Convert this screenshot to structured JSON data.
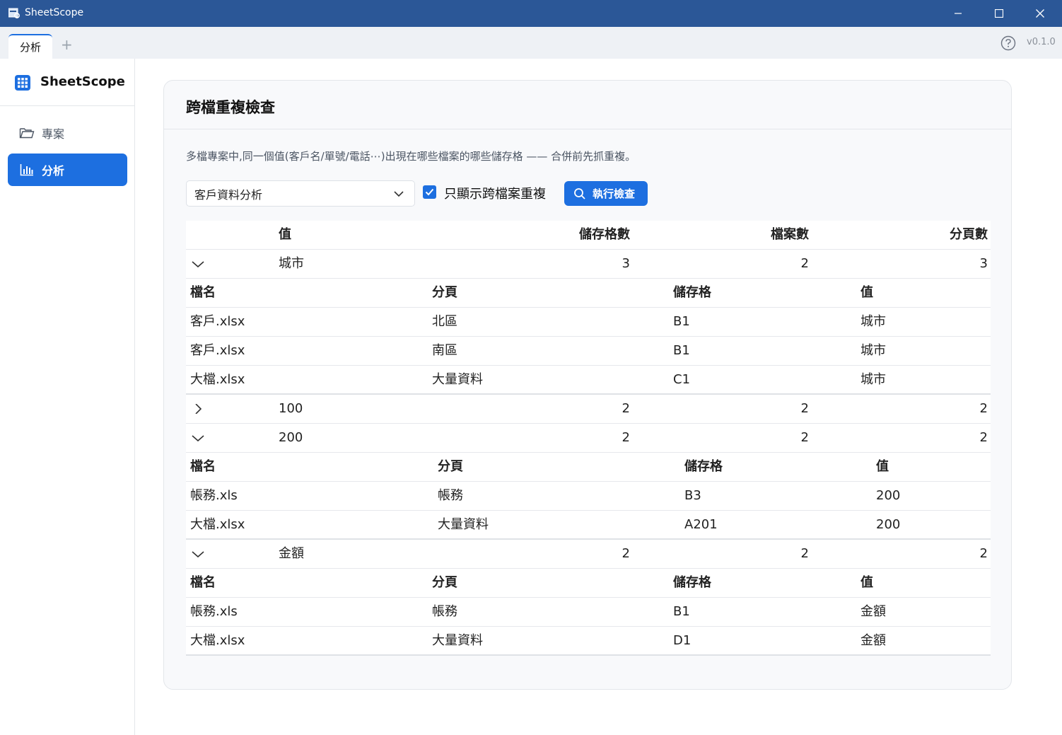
{
  "window": {
    "title": "SheetScope"
  },
  "tabs": {
    "active": "分析",
    "add": "+"
  },
  "header": {
    "version": "v0.1.0"
  },
  "sidebar": {
    "brand": "SheetScope",
    "items": [
      {
        "label": "專案",
        "icon": "folder-icon"
      },
      {
        "label": "分析",
        "icon": "bar-chart-icon"
      }
    ]
  },
  "main": {
    "title": "跨檔重複檢查",
    "description": "多檔專案中,同一個值(客戶名/單號/電話⋯)出現在哪些檔案的哪些儲存格 —— 合併前先抓重複。",
    "analysis_select": "客戶資料分析",
    "checkbox_label": "只顯示跨檔案重複",
    "checkbox_checked": true,
    "run_button": "執行檢查"
  },
  "table": {
    "columns": [
      "值",
      "儲存格數",
      "檔案數",
      "分頁數"
    ],
    "sub_columns": [
      "檔名",
      "分頁",
      "儲存格",
      "值"
    ],
    "groups": [
      {
        "value": "城市",
        "cells": "3",
        "files": "2",
        "sheets": "3",
        "expanded": true,
        "rows": [
          [
            "客戶.xlsx",
            "北區",
            "B1",
            "城市"
          ],
          [
            "客戶.xlsx",
            "南區",
            "B1",
            "城市"
          ],
          [
            "大檔.xlsx",
            "大量資料",
            "C1",
            "城市"
          ]
        ]
      },
      {
        "value": "100",
        "cells": "2",
        "files": "2",
        "sheets": "2",
        "expanded": false,
        "rows": []
      },
      {
        "value": "200",
        "cells": "2",
        "files": "2",
        "sheets": "2",
        "expanded": true,
        "rows": [
          [
            "帳務.xls",
            "帳務",
            "B3",
            "200"
          ],
          [
            "大檔.xlsx",
            "大量資料",
            "A201",
            "200"
          ]
        ]
      },
      {
        "value": "金額",
        "cells": "2",
        "files": "2",
        "sheets": "2",
        "expanded": true,
        "rows": [
          [
            "帳務.xls",
            "帳務",
            "B1",
            "金額"
          ],
          [
            "大檔.xlsx",
            "大量資料",
            "D1",
            "金額"
          ]
        ]
      }
    ]
  },
  "colors": {
    "accent": "#1d6fe0",
    "titlebar": "#2b5797"
  }
}
